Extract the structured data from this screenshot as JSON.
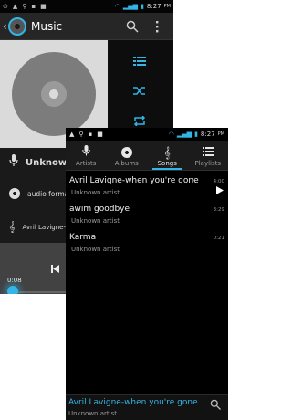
{
  "back_screen": {
    "status": {
      "icons": [
        "⊙",
        "▲",
        "⚲",
        "▪",
        "■"
      ],
      "time": "8:27",
      "ampm": "PM"
    },
    "app": {
      "title": "Music"
    },
    "info": {
      "artist": "Unknown a",
      "album": "audio format",
      "song": "Avril Lavigne-"
    },
    "progress": {
      "elapsed": "0:08",
      "fraction": 0.02
    }
  },
  "front_screen": {
    "status": {
      "icons": [
        "▲",
        "⚲",
        "▪",
        "■"
      ],
      "time": "8:27",
      "ampm": "PM"
    },
    "tabs": [
      {
        "label": "Artists",
        "icon": "mic-icon"
      },
      {
        "label": "Albums",
        "icon": "disc-icon"
      },
      {
        "label": "Songs",
        "icon": "music-note-icon"
      },
      {
        "label": "Playlists",
        "icon": "list-icon"
      }
    ],
    "active_tab": "Songs",
    "songs": [
      {
        "title": "Avril Lavigne-when you're gone",
        "artist": "Unknown artist",
        "duration": "4:00",
        "playing": true
      },
      {
        "title": "awim goodbye",
        "artist": "Unknown artist",
        "duration": "3:29",
        "playing": false
      },
      {
        "title": "Karma",
        "artist": "Unknown artist",
        "duration": "0:21",
        "playing": false
      }
    ],
    "now_playing": {
      "title": "Avril Lavigne-when you're gone",
      "artist": "Unknown artist"
    }
  },
  "colors": {
    "accent": "#33b5e5",
    "background": "#000000"
  }
}
